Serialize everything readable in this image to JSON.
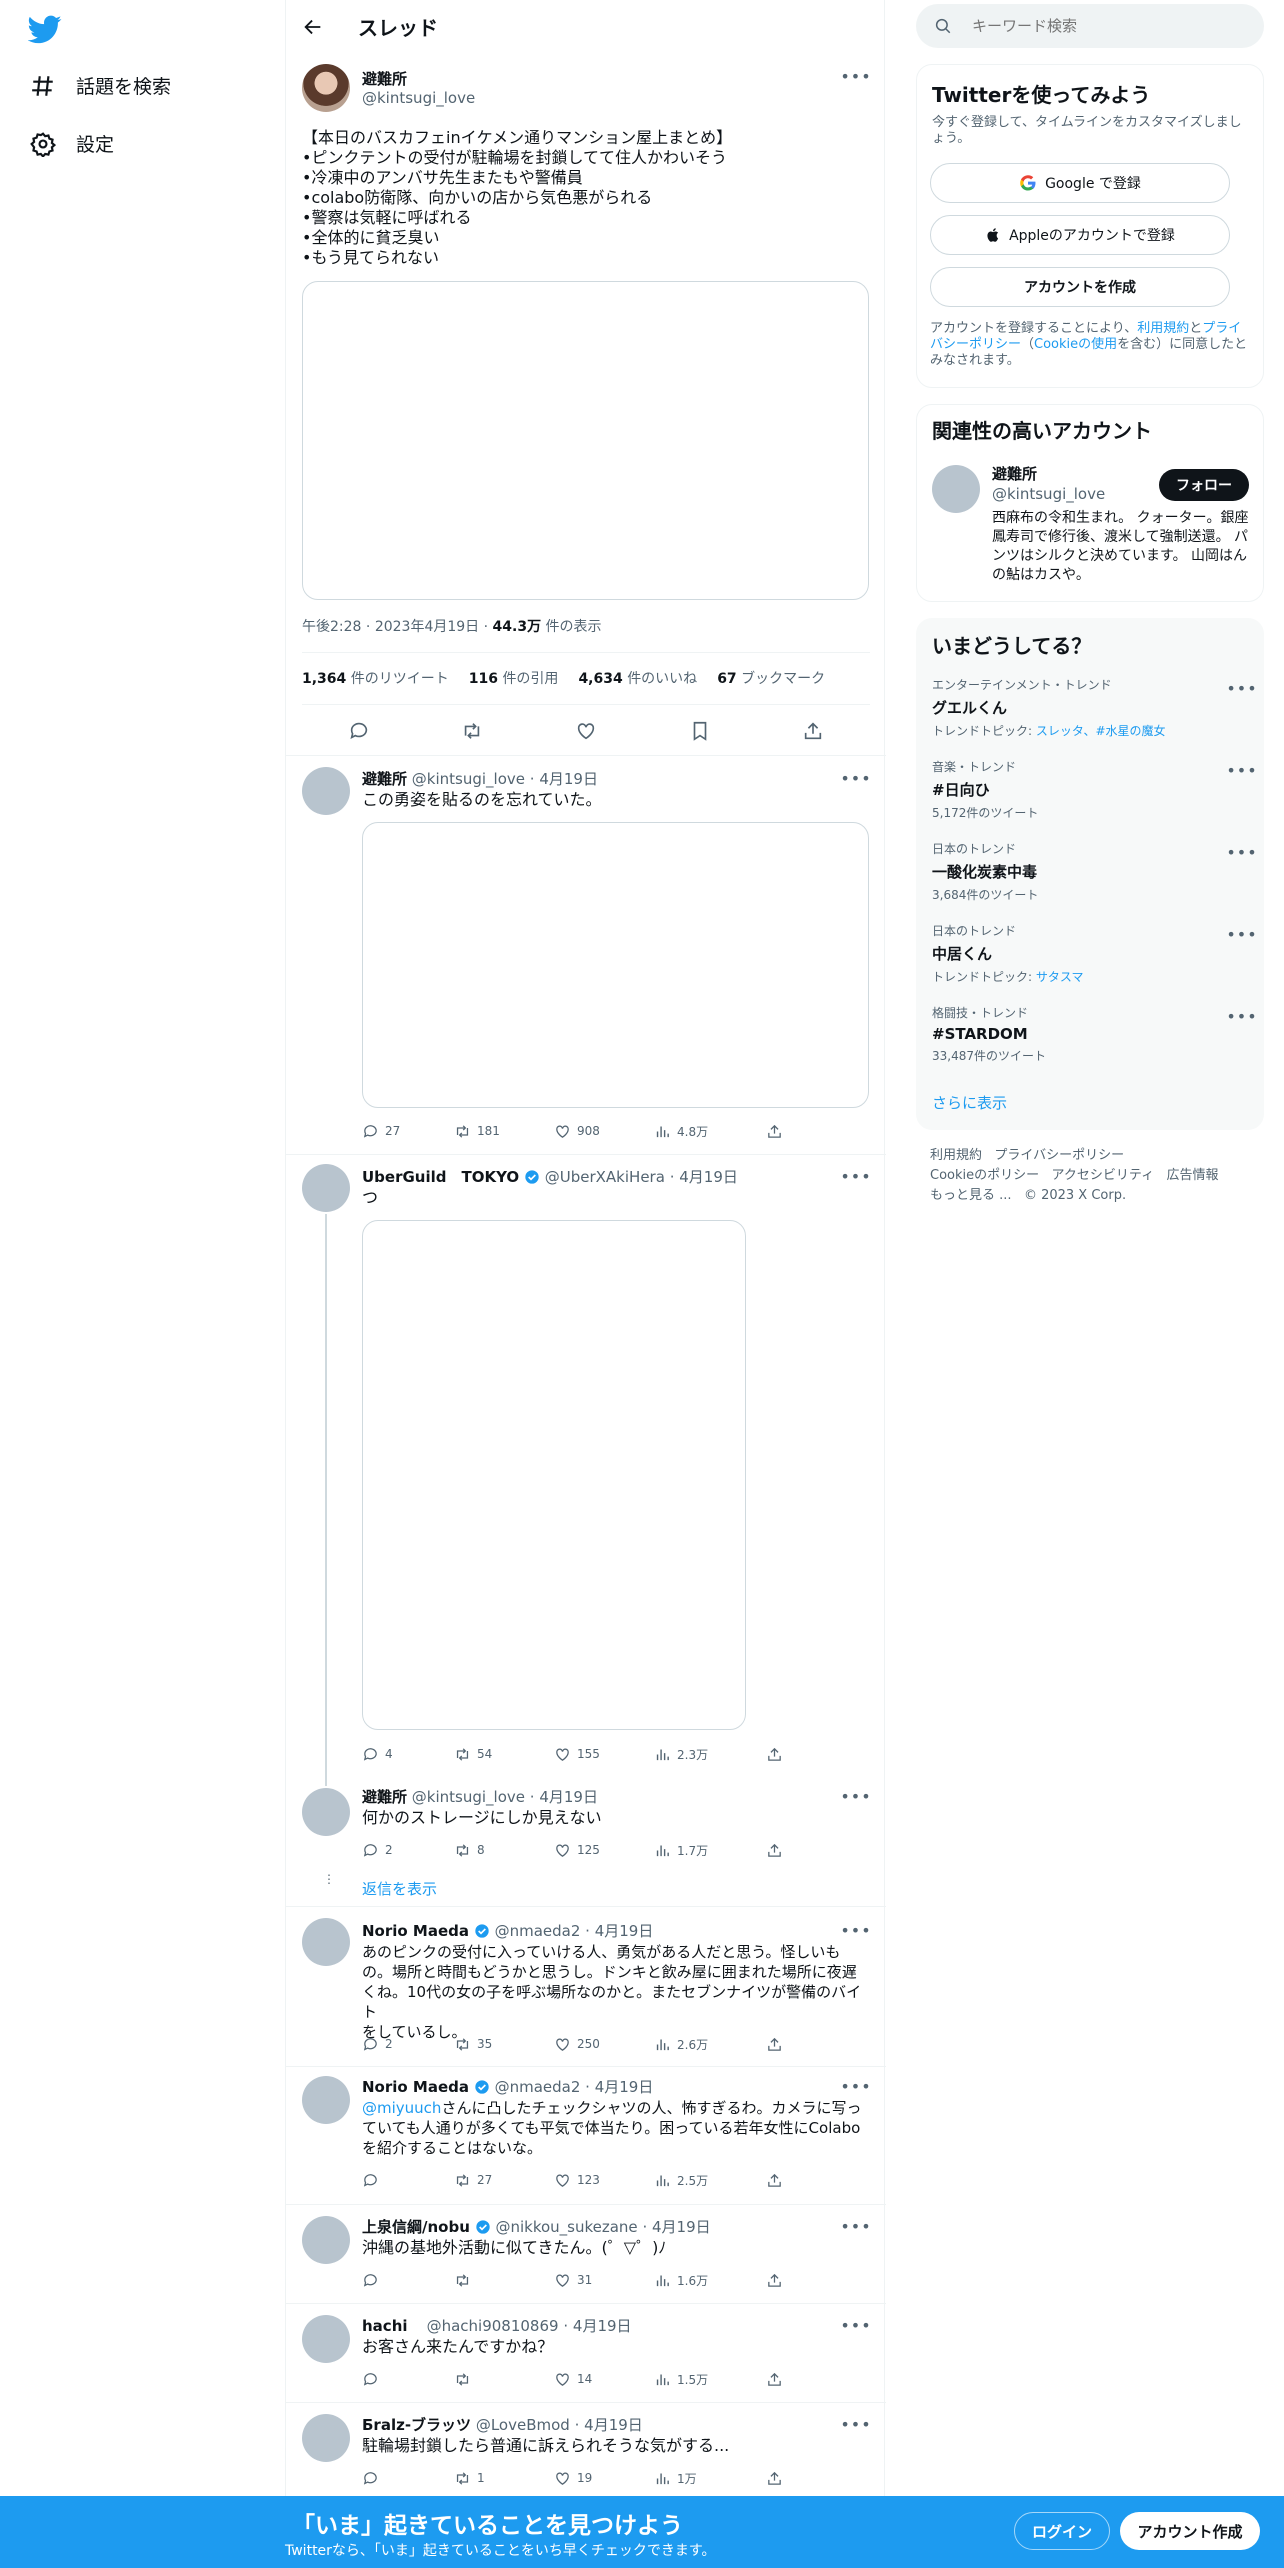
{
  "nav": {
    "explore_label": "話題を検索",
    "settings_label": "設定"
  },
  "header": {
    "title": "スレッド"
  },
  "main_tweet": {
    "name": "避難所",
    "handle": "@kintsugi_love",
    "lines": [
      "【本日のバスカフェinイケメン通りマンション屋上まとめ】",
      "•ピンクテントの受付が駐輪場を封鎖してて住人かわいそう",
      "•冷凍中のアンバサ先生またもや警備員",
      "•colabo防衛隊、向かいの店から気色悪がられる",
      "•警察は気軽に呼ばれる",
      "•全体的に貧乏臭い",
      "•もう見てられない"
    ],
    "time": "午後2:28",
    "date": "2023年4月19日",
    "views_num": "44.3万",
    "views_label": "件の表示",
    "stats": [
      {
        "num": "1,364",
        "label": "件のリツイート"
      },
      {
        "num": "116",
        "label": "件の引用"
      },
      {
        "num": "4,634",
        "label": "件のいいね"
      },
      {
        "num": "67",
        "label": "ブックマーク"
      }
    ]
  },
  "replies": [
    {
      "name": "避難所",
      "handle": "@kintsugi_love",
      "date": "4月19日",
      "text": "この勇姿を貼るのを忘れていた。",
      "reply": "27",
      "rt": "181",
      "like": "908",
      "views": "4.8万"
    },
    {
      "name": "UberGuild　TOKYO",
      "handle": "@UberXAkiHera",
      "date": "4月19日",
      "text": "つ",
      "reply": "4",
      "rt": "54",
      "like": "155",
      "views": "2.3万"
    },
    {
      "name": "避難所",
      "handle": "@kintsugi_love",
      "date": "4月19日",
      "text": "何かのストレージにしか見えない",
      "reply": "2",
      "rt": "8",
      "like": "125",
      "views": "1.7万"
    },
    {
      "name": "Norio Maeda",
      "handle": "@nmaeda2",
      "date": "4月19日",
      "lines": [
        "あのピンクの受付に入っていける人、勇気がある人だと思う。怪しいも",
        "の。場所と時間もどうかと思うし。ドンキと飲み屋に囲まれた場所に夜遅",
        "くね。10代の女の子を呼ぶ場所なのかと。またセブンナイツが警備のバイト",
        "をしているし。"
      ],
      "reply": "2",
      "rt": "35",
      "like": "250",
      "views": "2.6万"
    },
    {
      "name": "Norio Maeda",
      "handle": "@nmaeda2",
      "date": "4月19日",
      "mention": "@miyuuch",
      "lines": [
        "さんに凸したチェックシャツの人、怖すぎるわ。カメラに写っ",
        "ていても人通りが多くても平気で体当たり。困っている若年女性にColabo",
        "を紹介することはないな。"
      ],
      "reply": "",
      "rt": "27",
      "like": "123",
      "views": "2.5万"
    },
    {
      "name": "上泉信綱/nobu",
      "handle": "@nikkou_sukezane",
      "date": "4月19日",
      "text": "沖縄の基地外活動に似てきたん。(゜▽゜)ﾉ",
      "reply": "",
      "rt": "",
      "like": "31",
      "views": "1.6万"
    },
    {
      "name": "hachi",
      "handle": "@hachi90810869",
      "date": "4月19日",
      "text": "お客さん来たんですかね？",
      "reply": "",
      "rt": "",
      "like": "14",
      "views": "1.5万"
    },
    {
      "name": "Бralz-ブラッツ",
      "handle": "@LoveBmod",
      "date": "4月19日",
      "text": "駐輪場封鎖したら普通に訴えられそうな気がする...",
      "reply": "",
      "rt": "1",
      "like": "19",
      "views": "1万"
    }
  ],
  "show_replies": "返信を表示",
  "search": {
    "placeholder": "キーワード検索"
  },
  "signup": {
    "title": "Twitterを使ってみよう",
    "sub": "今すぐ登録して、タイムラインをカスタマイズしましょう。",
    "google": "Google で登録",
    "apple": "Appleのアカウントで登録",
    "create": "アカウントを作成",
    "legal_pre": "アカウントを登録することにより、",
    "legal_terms": "利用規約",
    "legal_and": "と",
    "legal_privacy": "プライバシーポリシー",
    "legal_paren": "（",
    "legal_cookie": "Cookieの使用",
    "legal_post": "を含む）に同意したとみなされます。"
  },
  "related": {
    "title": "関連性の高いアカウント",
    "name": "避難所",
    "handle": "@kintsugi_love",
    "follow": "フォロー",
    "bio": "西麻布の令和生まれ。 クォーター。銀座鳳寿司で修行後、渡米して強制送還。 パンツはシルクと決めています。 山岡はんの鮎はカスや。"
  },
  "trends": {
    "title": "いまどうしてる？",
    "items": [
      {
        "cat": "エンターテインメント・トレンド",
        "name": "グエルくん",
        "sub_label": "トレンドトピック: ",
        "topics": "スレッタ、#水星の魔女"
      },
      {
        "cat": "音楽・トレンド",
        "name": "#日向ひ",
        "sub": "5,172件のツイート"
      },
      {
        "cat": "日本のトレンド",
        "name": "一酸化炭素中毒",
        "sub": "3,684件のツイート"
      },
      {
        "cat": "日本のトレンド",
        "name": "中居くん",
        "sub_label": "トレンドトピック: ",
        "topics": "サタスマ"
      },
      {
        "cat": "格闘技・トレンド",
        "name": "#STARDOM",
        "sub": "33,487件のツイート"
      }
    ],
    "show_more": "さらに表示"
  },
  "footer": {
    "terms": "利用規約",
    "privacy": "プライバシーポリシー",
    "cookie": "Cookieのポリシー",
    "access": "アクセシビリティ",
    "ads": "広告情報",
    "more": "もっと見る ...",
    "copy": "© 2023 X Corp."
  },
  "bottom": {
    "title": "「いま」起きていることを見つけよう",
    "sub": "Twitterなら、「いま」起きていることをいち早くチェックできます。",
    "login": "ログイン",
    "signup": "アカウント作成"
  },
  "colors": {
    "brand": "#1d9bf0",
    "text": "#0f1419",
    "muted": "#536471"
  }
}
